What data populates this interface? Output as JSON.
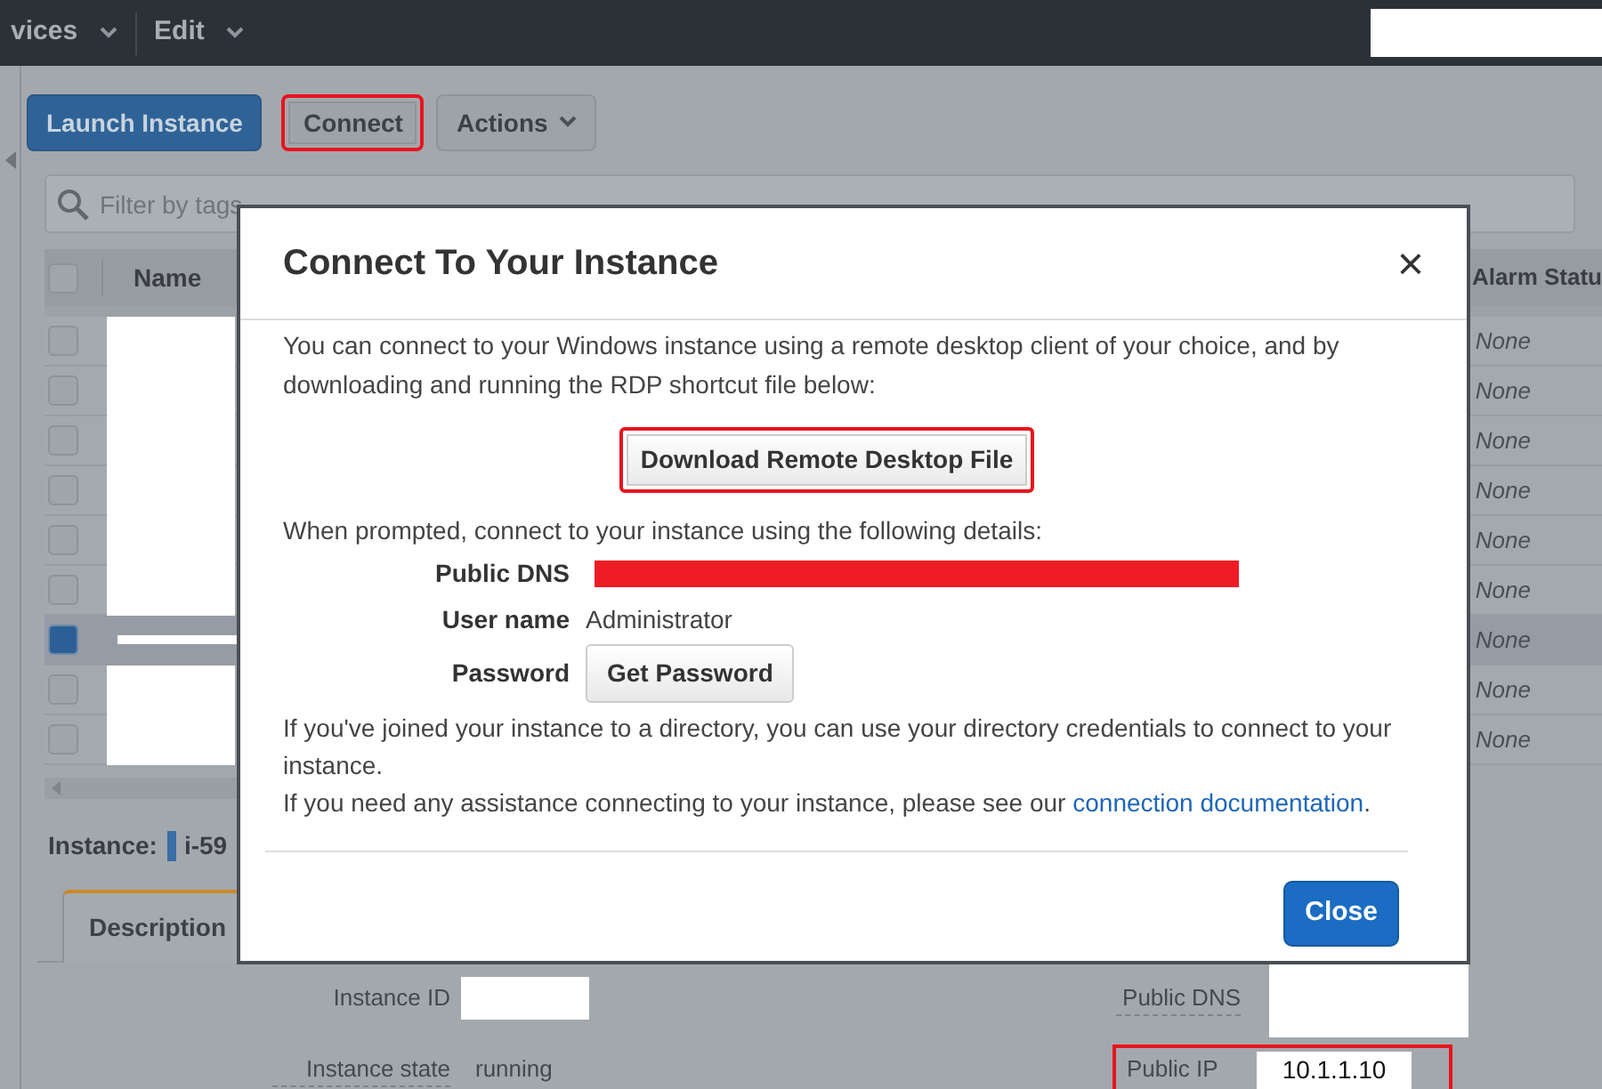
{
  "top_nav": {
    "menus": [
      {
        "label": "vices"
      },
      {
        "label": "Edit"
      }
    ],
    "redacted": true
  },
  "toolbar": {
    "buttons": [
      {
        "label": "Launch Instance",
        "kind": "primary",
        "highlighted": false
      },
      {
        "label": "Connect",
        "kind": "plain",
        "highlighted": true
      },
      {
        "label": "Actions",
        "kind": "dropdown",
        "highlighted": false
      }
    ]
  },
  "filter": {
    "placeholder": "Filter by tags"
  },
  "table": {
    "select_all": {
      "checked": false
    },
    "columns": [
      "Name",
      "Alarm Statu"
    ],
    "rows": [
      {
        "selected": false,
        "redacted": true,
        "alarm_status": "None"
      },
      {
        "selected": false,
        "redacted": true,
        "alarm_status": "None"
      },
      {
        "selected": false,
        "redacted": true,
        "alarm_status": "None"
      },
      {
        "selected": false,
        "redacted": true,
        "alarm_status": "None"
      },
      {
        "selected": false,
        "redacted": true,
        "alarm_status": "None"
      },
      {
        "selected": false,
        "redacted": true,
        "alarm_status": "None"
      },
      {
        "selected": true,
        "redacted": true,
        "alarm_status": "None"
      },
      {
        "selected": false,
        "redacted": true,
        "alarm_status": "None"
      },
      {
        "selected": false,
        "redacted": true,
        "alarm_status": "None"
      }
    ]
  },
  "instance_bar": {
    "label": "Instance:",
    "id": "i-59"
  },
  "tabs": [
    {
      "label": "Description",
      "selected": true
    }
  ],
  "details": {
    "left": [
      {
        "label": "Instance ID",
        "redacted": true
      },
      {
        "label": "Instance state",
        "value": "running"
      }
    ],
    "right": [
      {
        "label": "Public DNS",
        "redacted": true
      },
      {
        "label": "Public IP",
        "value": "10.1.1.10",
        "highlighted": true
      }
    ]
  },
  "modal": {
    "title": "Connect To Your Instance",
    "close": "×",
    "intro": "You can connect to your Windows instance using a remote desktop client of your choice, and by downloading and running the RDP shortcut file below:",
    "download_button": {
      "label": "Download Remote Desktop File",
      "highlighted": true
    },
    "prompt": "When prompted, connect to your instance using the following details:",
    "fields": [
      {
        "label": "Public DNS",
        "kind": "redacted"
      },
      {
        "label": "User name",
        "kind": "text",
        "value": "Administrator"
      },
      {
        "label": "Password",
        "kind": "button",
        "button": "Get Password"
      }
    ],
    "directory_note": "If you've joined your instance to a directory, you can use your directory credentials to connect to your instance.",
    "help": {
      "text": "If you need any assistance connecting to your instance, please see our",
      "link": "connection documentation",
      "end": "."
    },
    "footer_button": "Close"
  }
}
